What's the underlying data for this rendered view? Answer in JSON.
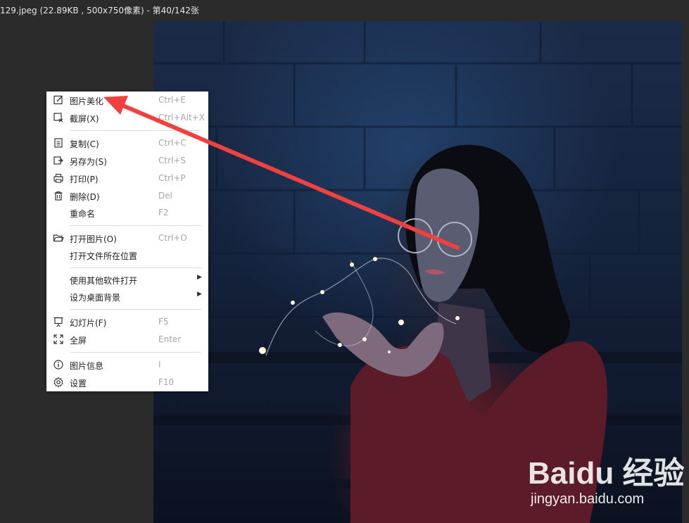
{
  "window": {
    "title": "129.jpeg (22.89KB , 500x750像素) - 第40/142张"
  },
  "context_menu": {
    "items": [
      {
        "label": "图片美化",
        "shortcut": "Ctrl+E",
        "icon": "edit-icon"
      },
      {
        "label": "截屏(X)",
        "shortcut": "Ctrl+Alt+X",
        "icon": "screenshot-icon"
      },
      {
        "label": "复制(C)",
        "shortcut": "Ctrl+C",
        "icon": "copy-icon"
      },
      {
        "label": "另存为(S)",
        "shortcut": "Ctrl+S",
        "icon": "save-as-icon"
      },
      {
        "label": "打印(P)",
        "shortcut": "Ctrl+P",
        "icon": "printer-icon"
      },
      {
        "label": "删除(D)",
        "shortcut": "Del",
        "icon": "trash-icon"
      },
      {
        "label": "重命名",
        "shortcut": "F2",
        "icon": ""
      },
      {
        "label": "打开图片(O)",
        "shortcut": "Ctrl+O",
        "icon": "folder-icon"
      },
      {
        "label": "打开文件所在位置",
        "shortcut": "",
        "icon": ""
      },
      {
        "label": "使用其他软件打开",
        "shortcut": "",
        "icon": "",
        "submenu": true
      },
      {
        "label": "设为桌面背景",
        "shortcut": "",
        "icon": "",
        "submenu": true
      },
      {
        "label": "幻灯片(F)",
        "shortcut": "F5",
        "icon": "slideshow-icon"
      },
      {
        "label": "全屏",
        "shortcut": "Enter",
        "icon": "fullscreen-icon"
      },
      {
        "label": "图片信息",
        "shortcut": "I",
        "icon": "info-icon"
      },
      {
        "label": "设置",
        "shortcut": "F10",
        "icon": "gear-icon"
      }
    ]
  },
  "watermark": {
    "logo": "Baidu 经验",
    "url": "jingyan.baidu.com"
  },
  "colors": {
    "annotation_arrow": "#f04040",
    "menu_bg": "#ffffff",
    "viewer_bg": "#2b2b2b"
  }
}
